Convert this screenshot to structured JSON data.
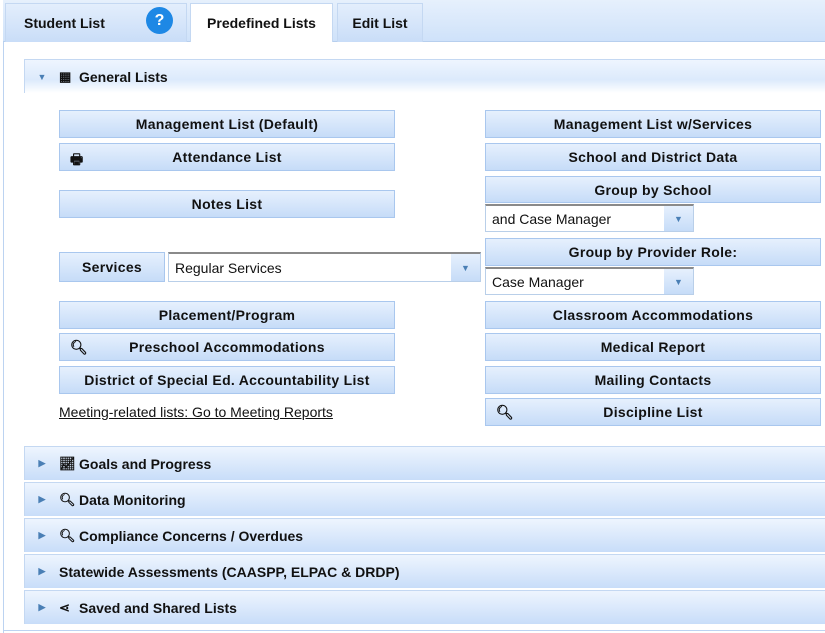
{
  "tabs": {
    "student_list": "Student List",
    "help": "?",
    "predefined": "Predefined Lists",
    "edit": "Edit List"
  },
  "general": {
    "title": "General Lists",
    "left": {
      "management_default": "Management List (Default)",
      "attendance": "Attendance List",
      "notes": "Notes List",
      "services_label": "Services",
      "services_value": "Regular Services",
      "placement": "Placement/Program",
      "preschool": "Preschool Accommodations",
      "district": "District of Special Ed. Accountability List",
      "meeting_link": "Meeting-related lists: Go to Meeting Reports"
    },
    "right": {
      "management_services": "Management List w/Services",
      "school_district": "School and District Data",
      "group_school": "Group by School",
      "group_school_value": "and Case Manager",
      "group_provider": "Group by Provider Role:",
      "group_provider_value": "Case Manager",
      "classroom": "Classroom Accommodations",
      "medical": "Medical Report",
      "mailing": "Mailing Contacts",
      "discipline": "Discipline List"
    }
  },
  "sections": [
    "Goals and Progress",
    "Data Monitoring",
    "Compliance Concerns / Overdues",
    "Statewide Assessments (CAASPP, ELPAC & DRDP)",
    "Saved and Shared Lists"
  ]
}
